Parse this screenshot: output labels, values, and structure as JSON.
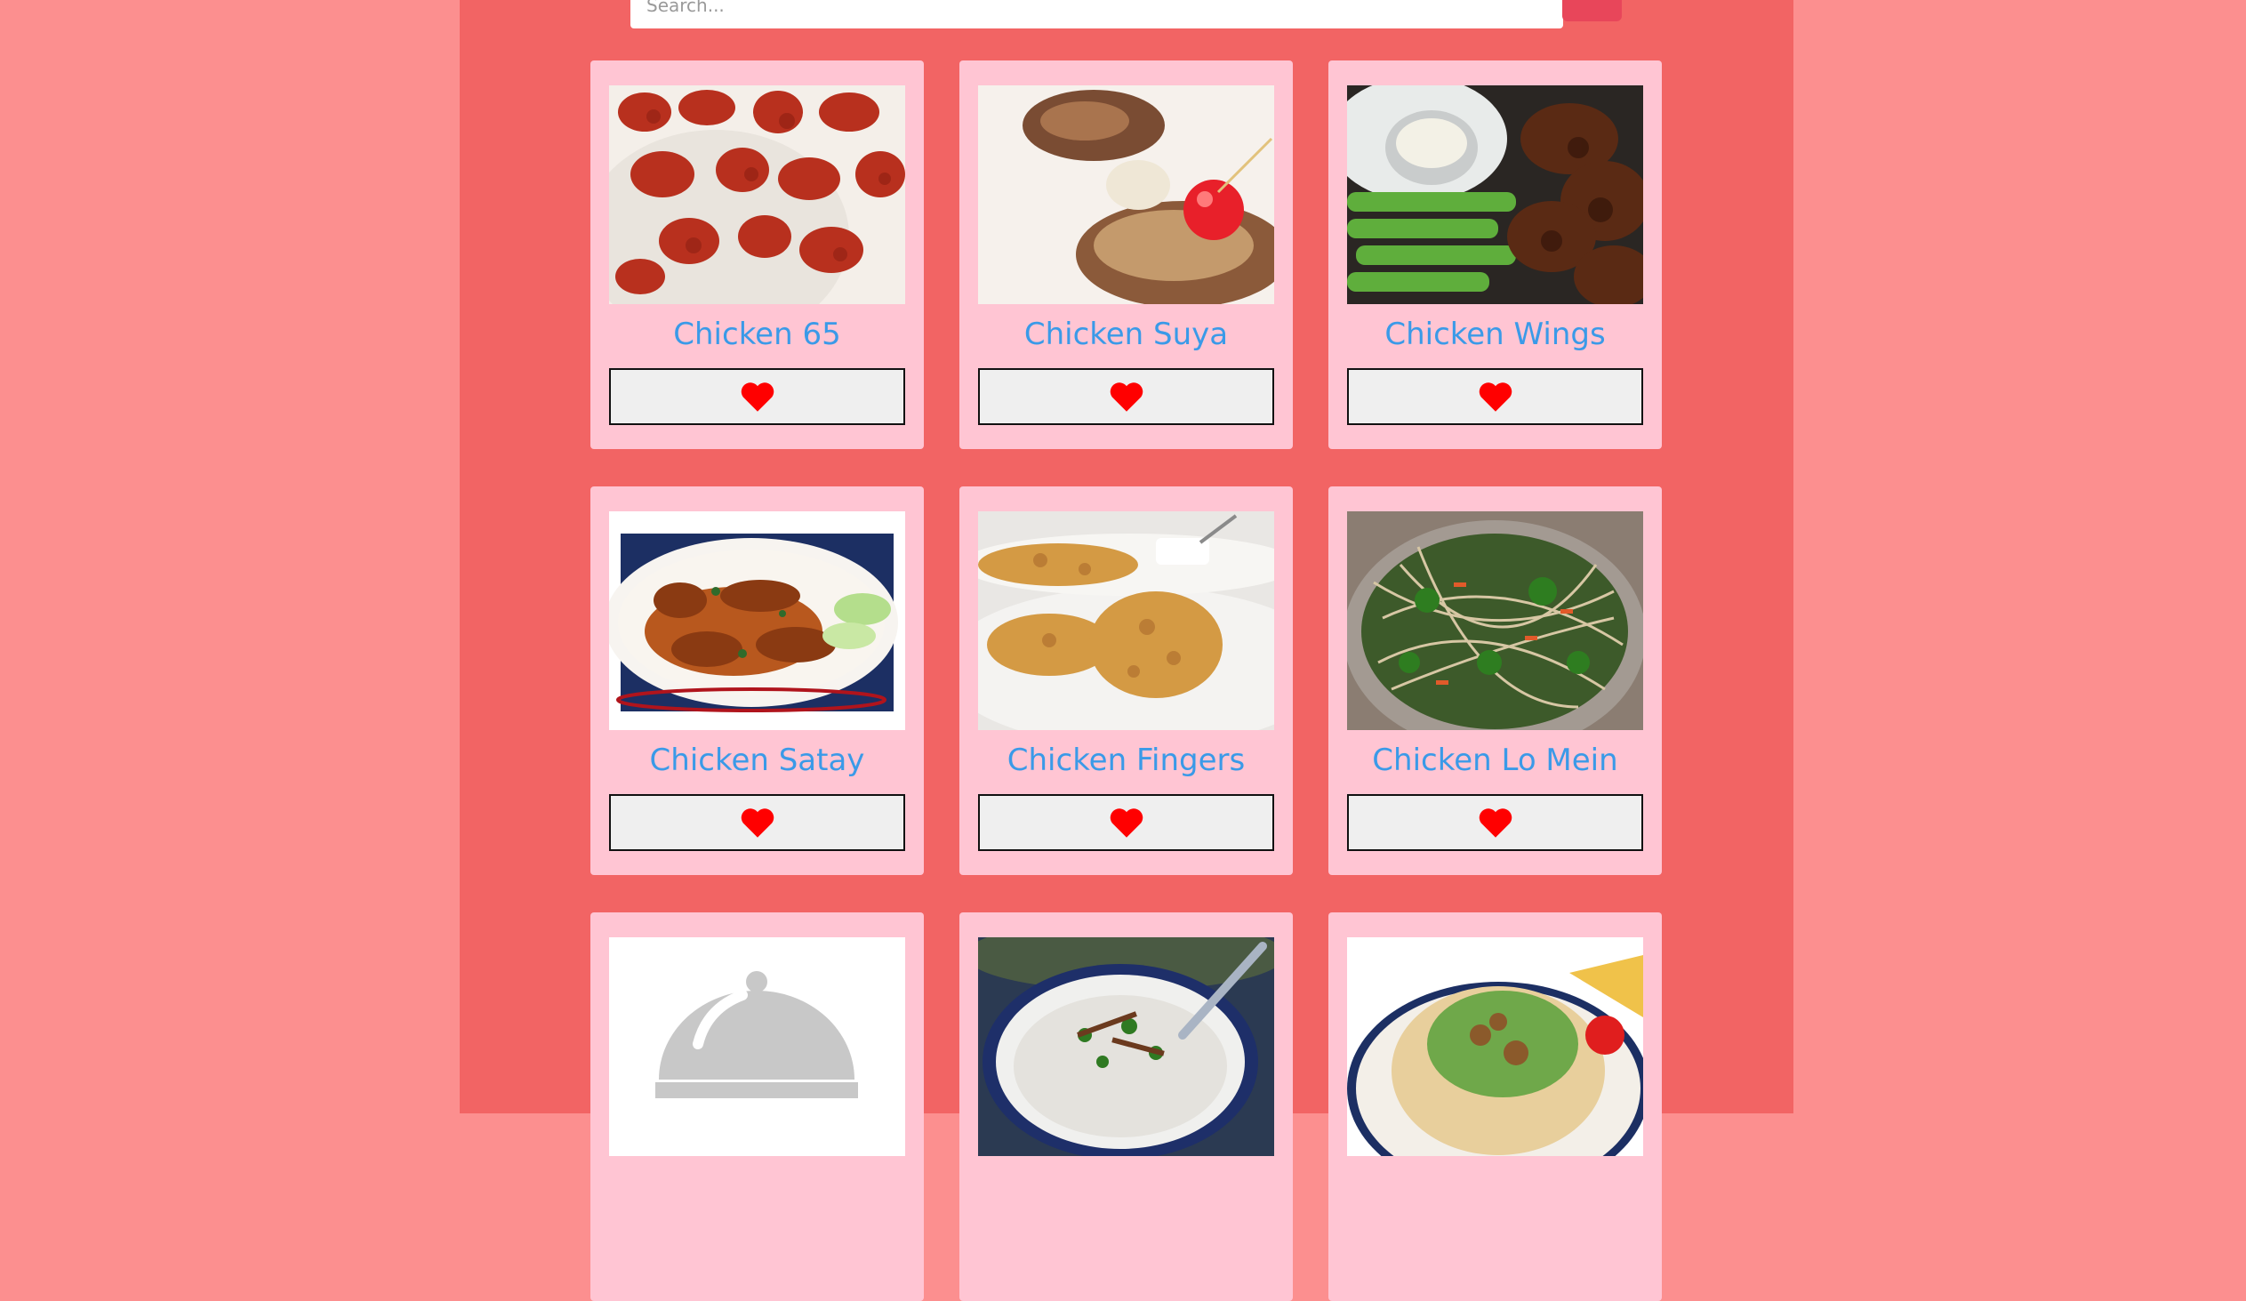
{
  "search": {
    "placeholder": "Search..."
  },
  "colors": {
    "page_background": "#fc8f8f",
    "content_background": "#f26464",
    "card_background": "#ffc5d3",
    "title_color": "#3a9ae8",
    "heart_color": "#ff0000",
    "search_button": "#e8465a"
  },
  "recipes": [
    {
      "title": "Chicken 65",
      "favorite_icon": "heart-icon"
    },
    {
      "title": "Chicken Suya",
      "favorite_icon": "heart-icon"
    },
    {
      "title": "Chicken Wings",
      "favorite_icon": "heart-icon"
    },
    {
      "title": "Chicken Satay",
      "favorite_icon": "heart-icon"
    },
    {
      "title": "Chicken Fingers",
      "favorite_icon": "heart-icon"
    },
    {
      "title": "Chicken Lo Mein",
      "favorite_icon": "heart-icon"
    },
    {
      "title": "",
      "image": "placeholder-cloche-icon"
    },
    {
      "title": ""
    },
    {
      "title": ""
    }
  ]
}
